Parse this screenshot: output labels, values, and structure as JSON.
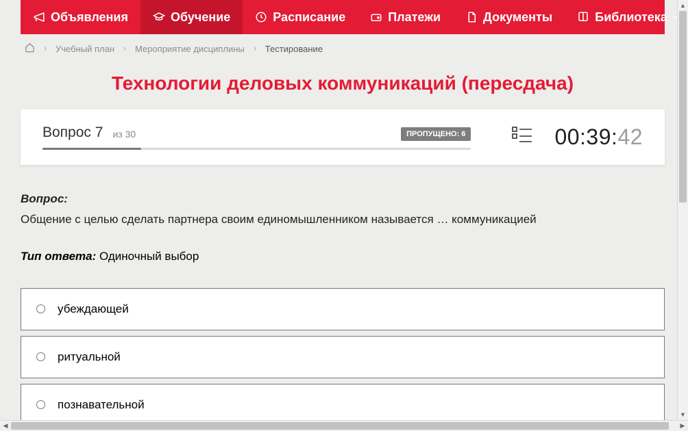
{
  "nav": {
    "items": [
      {
        "label": "Объявления",
        "icon": "megaphone"
      },
      {
        "label": "Обучение",
        "icon": "graduation"
      },
      {
        "label": "Расписание",
        "icon": "clock"
      },
      {
        "label": "Платежи",
        "icon": "wallet"
      },
      {
        "label": "Документы",
        "icon": "document"
      },
      {
        "label": "Библиотека",
        "icon": "book",
        "chevron": true
      }
    ],
    "active_index": 1
  },
  "breadcrumb": {
    "items": [
      "Учебный план",
      "Мероприятие дисциплины",
      "Тестирование"
    ]
  },
  "page_title": "Технологии деловых коммуникаций (пересдача)",
  "status": {
    "question_label": "Вопрос 7",
    "question_of": "из 30",
    "skipped_label": "ПРОПУЩЕНО: 6",
    "progress_percent": 23,
    "timer_main": "00:39:",
    "timer_seconds": "42"
  },
  "question": {
    "heading": "Вопрос:",
    "text": "Общение с целью сделать партнера своим единомышленником называется … коммуникацией",
    "answer_type_label": "Тип ответа:",
    "answer_type_value": "Одиночный выбор",
    "options": [
      "убеждающей",
      "ритуальной",
      "познавательной"
    ]
  }
}
